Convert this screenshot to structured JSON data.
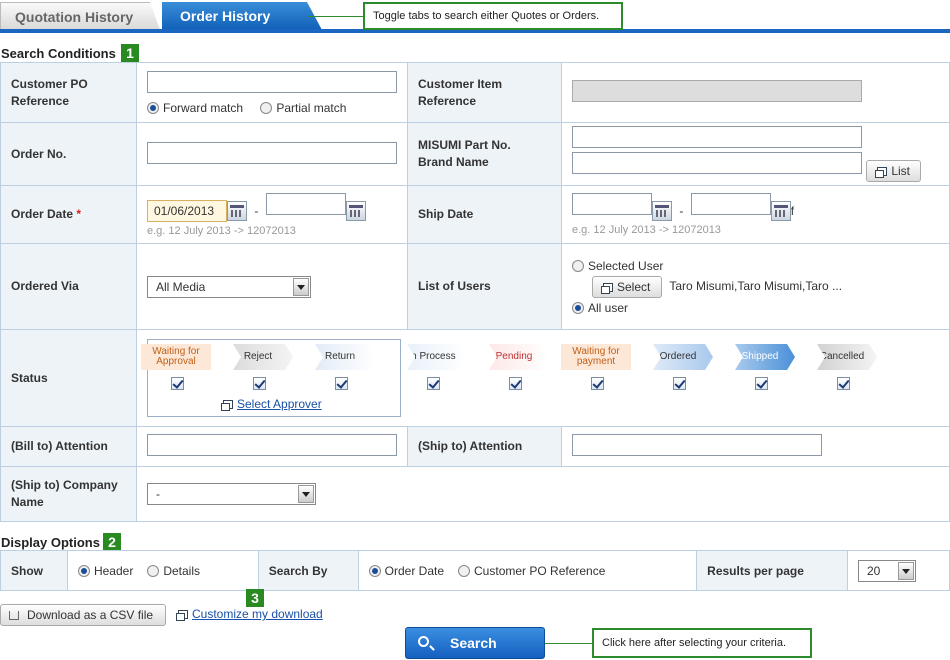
{
  "tabs": [
    {
      "label": "Quotation History",
      "active": false
    },
    {
      "label": "Order History",
      "active": true
    }
  ],
  "callouts": {
    "tabs": "Toggle tabs to search either Quotes or Orders.",
    "search": "Click here after selecting your criteria."
  },
  "badges": {
    "one": "1",
    "two": "2",
    "three": "3"
  },
  "search_conditions": {
    "title": "Search Conditions",
    "customer_po": {
      "label": "Customer PO Reference",
      "value": "",
      "match_options": [
        "Forward match",
        "Partial match"
      ],
      "selected_match": "Forward match"
    },
    "customer_item": {
      "label": "Customer Item Reference",
      "value": ""
    },
    "order_no": {
      "label": "Order No.",
      "value": ""
    },
    "part_no": {
      "label_line1": "MISUMI Part No.",
      "label_line2": "Brand Name",
      "value1": "",
      "value2": "",
      "list_button": "List"
    },
    "order_date": {
      "label": "Order Date",
      "required_mark": "*",
      "from": "01/06/2013",
      "to": "",
      "dash": "-",
      "hint": "e.g. 12 July 2013 -> 12072013"
    },
    "ship_date": {
      "label": "Ship Date",
      "from": "",
      "to": "",
      "dash": "-",
      "trailing": "f",
      "hint": "e.g. 12 July 2013 -> 12072013"
    },
    "ordered_via": {
      "label": "Ordered Via",
      "selected": "All Media"
    },
    "list_of_users": {
      "label": "List of Users",
      "selected_user_option": "Selected User",
      "select_button": "Select",
      "selected_users": "Taro Misumi,Taro Misumi,Taro ...",
      "all_user_option": "All user",
      "selected": "All user"
    },
    "status": {
      "label": "Status",
      "approval_group": [
        {
          "label": "Waiting for Approval",
          "checked": true,
          "color": "#c06018"
        },
        {
          "label": "Reject",
          "checked": true,
          "color": "#333333"
        },
        {
          "label": "Return",
          "checked": true,
          "color": "#333333"
        }
      ],
      "select_approver_link": "Select Approver",
      "other_statuses": [
        {
          "label": "In Process",
          "checked": true,
          "color": "#333333"
        },
        {
          "label": "Pending",
          "checked": true,
          "color": "#c03030"
        },
        {
          "label": "Waiting for payment",
          "checked": true,
          "color": "#c06018"
        },
        {
          "label": "Ordered",
          "checked": true,
          "color": "#333333"
        },
        {
          "label": "Shipped",
          "checked": true,
          "color": "#ffffff"
        },
        {
          "label": "Cancelled",
          "checked": true,
          "color": "#333333"
        }
      ]
    },
    "bill_attention": {
      "label": "(Bill to) Attention",
      "value": ""
    },
    "ship_attention": {
      "label": "(Ship to) Attention",
      "value": ""
    },
    "ship_company": {
      "label": "(Ship to) Company Name",
      "selected": "-"
    }
  },
  "display_options": {
    "title": "Display Options",
    "show_label": "Show",
    "show_options": [
      "Header",
      "Details"
    ],
    "show_selected": "Header",
    "search_by_label": "Search By",
    "search_by_options": [
      "Order Date",
      "Customer PO Reference"
    ],
    "search_by_selected": "Order Date",
    "results_label": "Results per page",
    "results_value": "20"
  },
  "download": {
    "csv_button": "Download as a CSV file",
    "customize_link": "Customize my download"
  },
  "search_button": "Search"
}
